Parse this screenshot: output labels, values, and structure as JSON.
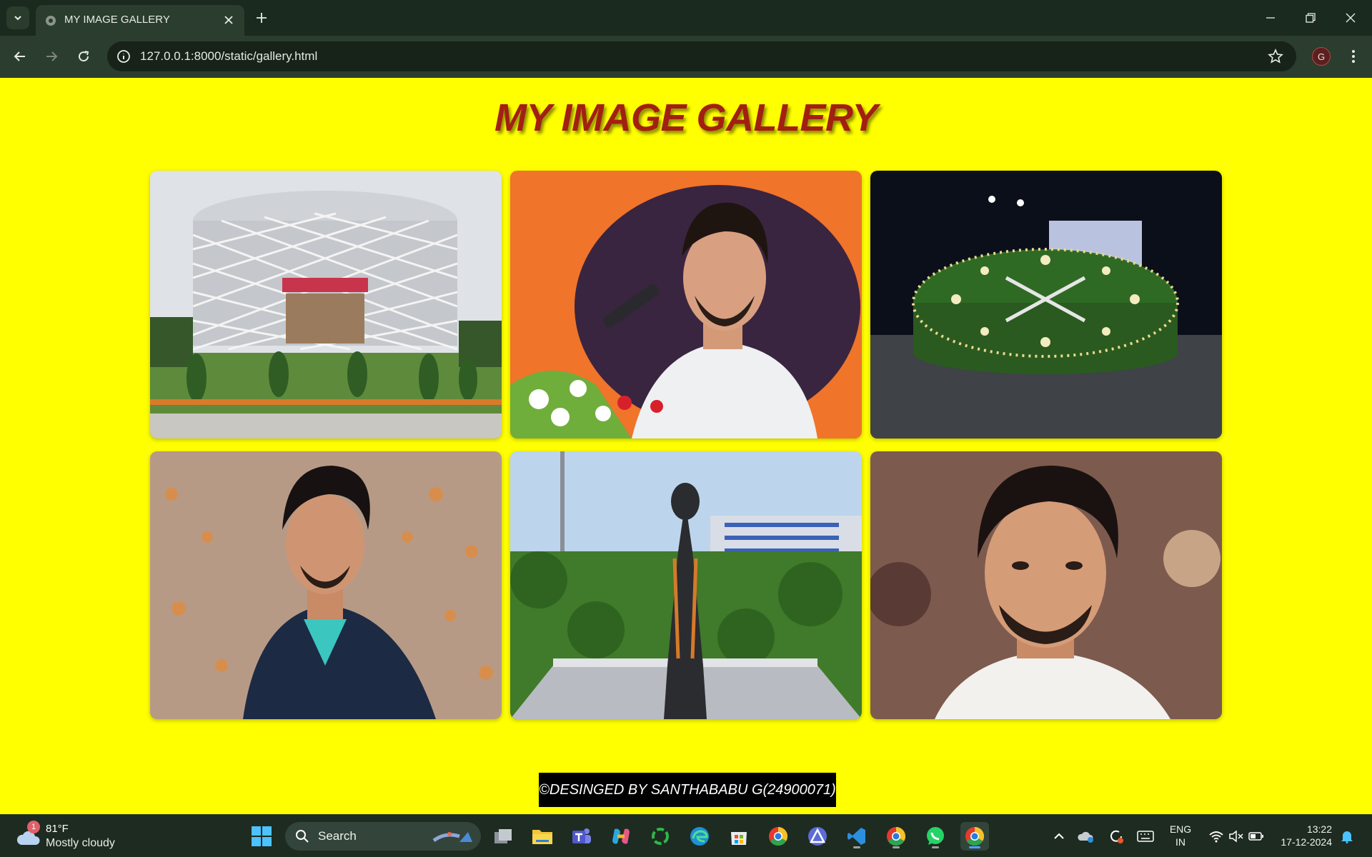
{
  "browser": {
    "tab_title": "MY IMAGE GALLERY",
    "url": "127.0.0.1:8000/static/gallery.html",
    "profile_initial": "G"
  },
  "page": {
    "title": "MY IMAGE GALLERY",
    "footer": "©DESINGED BY SANTHABABU G(24900071)"
  },
  "gallery": {
    "images": [
      {
        "subject": "college-building"
      },
      {
        "subject": "man-speaking-at-microphone"
      },
      {
        "subject": "floral-clock-at-night"
      },
      {
        "subject": "man-portrait-outdoors"
      },
      {
        "subject": "statue-with-hospital"
      },
      {
        "subject": "man-close-up-portrait"
      }
    ]
  },
  "taskbar": {
    "weather_badge": "1",
    "weather_temp": "81°F",
    "weather_condition": "Mostly cloudy",
    "search_label": "Search",
    "language_top": "ENG",
    "language_bottom": "IN",
    "time": "13:22",
    "date": "17-12-2024"
  },
  "colors": {
    "page_background": "#ffff00",
    "title": "#a31f12",
    "footer_background": "#000000",
    "chrome": "#1b2a1e"
  }
}
